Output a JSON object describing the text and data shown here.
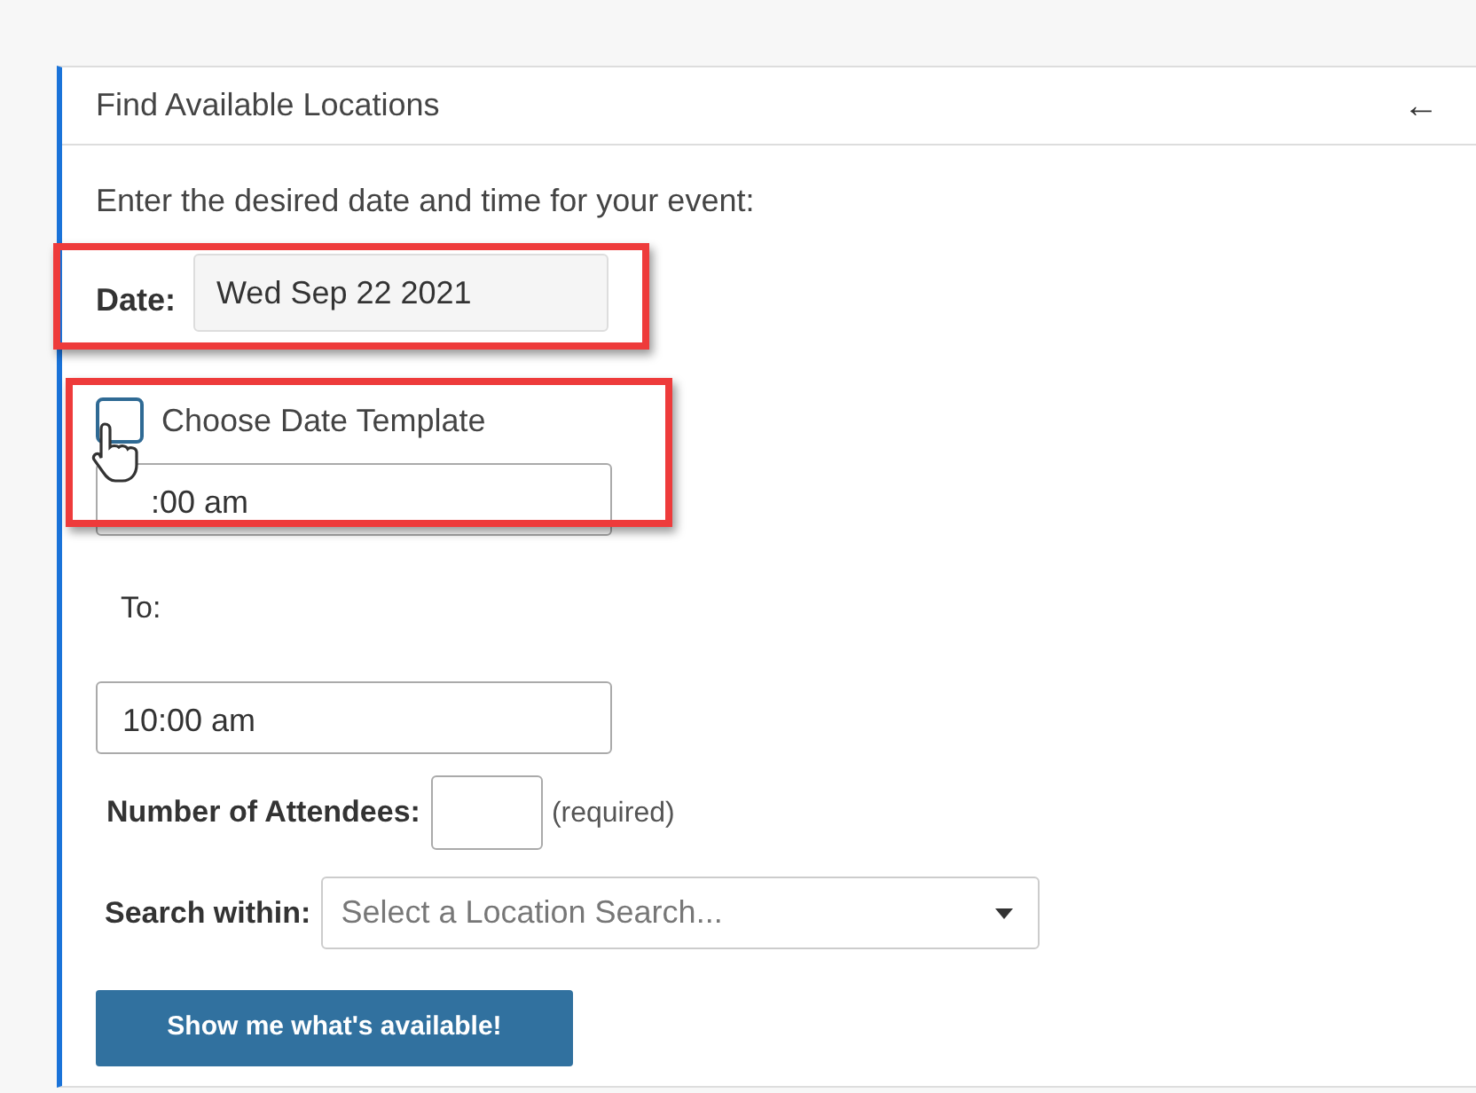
{
  "panel": {
    "title": "Find Available Locations",
    "back_icon": "←"
  },
  "instructions": "Enter the desired date and time for your event:",
  "date": {
    "label": "Date:",
    "value": "Wed Sep 22 2021"
  },
  "template": {
    "label": "Choose Date Template",
    "checked": false
  },
  "from_time": {
    "value": ":00 am"
  },
  "to": {
    "label": "To:",
    "value": "10:00 am"
  },
  "attendees": {
    "label": "Number of Attendees:",
    "note": "(required)"
  },
  "search_within": {
    "label": "Search within:",
    "placeholder": "Select a Location Search..."
  },
  "submit": "Show me what's available!"
}
